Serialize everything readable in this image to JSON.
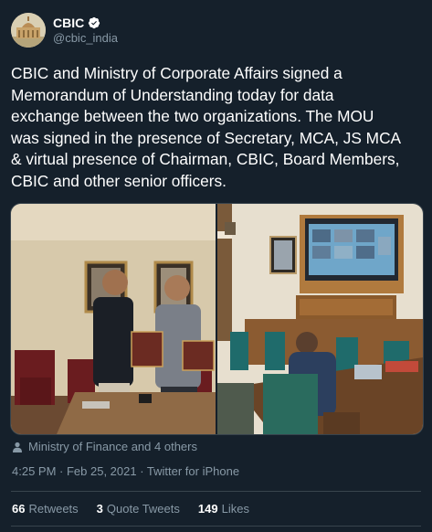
{
  "account": {
    "name": "CBIC",
    "handle": "@cbic_india"
  },
  "tweet": {
    "text": "CBIC and Ministry of Corporate Affairs signed a\nMemorandum of Understanding today for data\nexchange between the two organizations. The MOU\nwas signed in the presence of Secretary, MCA, JS MCA\n& virtual presence of Chairman, CBIC, Board Members,\nCBIC and other senior officers.",
    "tagged": "Ministry of Finance and 4 others",
    "timestamp": "4:25 PM · Feb 25, 2021 · Twitter for iPhone"
  },
  "stats": {
    "retweets_count": "66",
    "retweets_label": "Retweets",
    "quotes_count": "3",
    "quotes_label": "Quote Tweets",
    "likes_count": "149",
    "likes_label": "Likes"
  },
  "colors": {
    "background": "#15202b",
    "secondary_text": "#8899a6",
    "verified_badge": "#ffffff",
    "divider": "#38444d"
  },
  "icons": {
    "verified": "verified-badge-icon",
    "tagged": "person-icon"
  }
}
